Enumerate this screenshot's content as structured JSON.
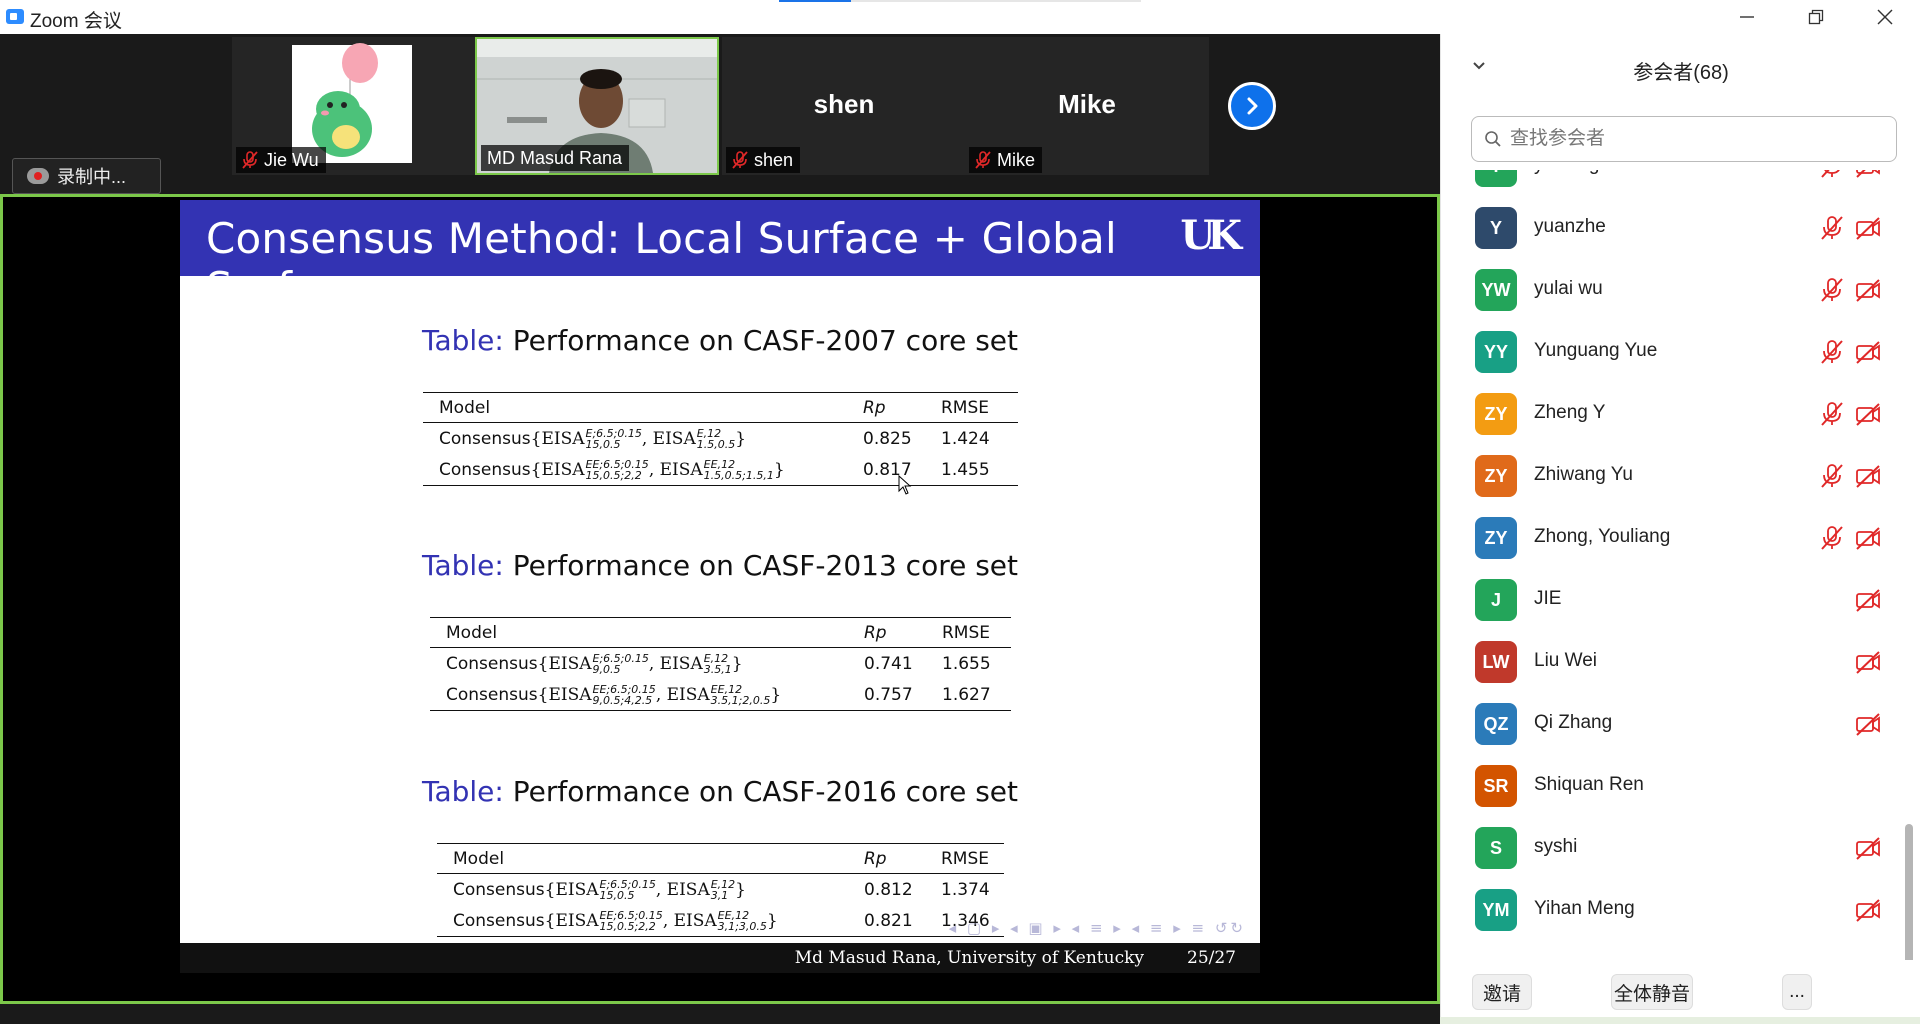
{
  "window": {
    "title": "Zoom 会议",
    "progress": 0.2
  },
  "gallery": {
    "tiles": [
      {
        "name": "Jie Wu",
        "big_name": ""
      },
      {
        "name": "MD Masud Rana",
        "big_name": ""
      },
      {
        "name": "shen",
        "big_name": "shen"
      },
      {
        "name": "Mike",
        "big_name": "Mike"
      }
    ]
  },
  "recording": {
    "label": "录制中..."
  },
  "slide": {
    "title": "Consensus Method:  Local Surface + Global Surface",
    "logo": "UK",
    "caption_prefix": "Table:",
    "tables": [
      {
        "caption": " Performance on CASF-2007 core set",
        "headers": {
          "model": "Model",
          "rp": "Rp",
          "rmse": "RMSE"
        },
        "rows": [
          {
            "model_prefix": "Consensus",
            "a_sup": "E;6.5;0.15",
            "a_sub": "15,0.5",
            "b_sup": "E,12",
            "b_sub": "1.5,0.5",
            "rp": "0.825",
            "rmse": "1.424"
          },
          {
            "model_prefix": "Consensus",
            "a_sup": "EE;6.5;0.15",
            "a_sub": "15,0.5;2,2",
            "b_sup": "EE,12",
            "b_sub": "1.5,0.5;1.5,1",
            "rp": "0.817",
            "rmse": "1.455"
          }
        ]
      },
      {
        "caption": " Performance on CASF-2013 core set",
        "headers": {
          "model": "Model",
          "rp": "Rp",
          "rmse": "RMSE"
        },
        "rows": [
          {
            "model_prefix": "Consensus",
            "a_sup": "E;6.5;0.15",
            "a_sub": "9,0.5",
            "b_sup": "E,12",
            "b_sub": "3.5,1",
            "rp": "0.741",
            "rmse": "1.655"
          },
          {
            "model_prefix": "Consensus",
            "a_sup": "EE;6.5;0.15",
            "a_sub": "9,0.5;4,2.5",
            "b_sup": "EE,12",
            "b_sub": "3.5,1;2,0.5",
            "rp": "0.757",
            "rmse": "1.627"
          }
        ]
      },
      {
        "caption": " Performance on CASF-2016 core set",
        "headers": {
          "model": "Model",
          "rp": "Rp",
          "rmse": "RMSE"
        },
        "rows": [
          {
            "model_prefix": "Consensus",
            "a_sup": "E;6.5;0.15",
            "a_sub": "15,0.5",
            "b_sup": "E,12",
            "b_sub": "3,1",
            "rp": "0.812",
            "rmse": "1.374"
          },
          {
            "model_prefix": "Consensus",
            "a_sup": "EE;6.5;0.15",
            "a_sub": "15,0.5;2,2",
            "b_sup": "EE,12",
            "b_sub": "3,1;3,0.5",
            "rp": "0.821",
            "rmse": "1.346"
          }
        ]
      }
    ],
    "footer_author": "Md Masud Rana, University of Kentucky",
    "footer_page": "25/27"
  },
  "participants": {
    "title": "参会者(68)",
    "search_placeholder": "查找参会者",
    "list": [
      {
        "initials": "Y",
        "name": "yisheng",
        "color": "#23a55a",
        "mic_muted": true,
        "video_off": true
      },
      {
        "initials": "Y",
        "name": "yuanzhe",
        "color": "#2e4a6b",
        "mic_muted": true,
        "video_off": true
      },
      {
        "initials": "YW",
        "name": "yulai wu",
        "color": "#23a55a",
        "mic_muted": true,
        "video_off": true
      },
      {
        "initials": "YY",
        "name": "Yunguang Yue",
        "color": "#18a085",
        "mic_muted": true,
        "video_off": true
      },
      {
        "initials": "ZY",
        "name": "Zheng Y",
        "color": "#f39c12",
        "mic_muted": true,
        "video_off": true
      },
      {
        "initials": "ZY",
        "name": "Zhiwang Yu",
        "color": "#e06a1a",
        "mic_muted": true,
        "video_off": true
      },
      {
        "initials": "ZY",
        "name": "Zhong, Youliang",
        "color": "#2b7bb9",
        "mic_muted": true,
        "video_off": true
      },
      {
        "initials": "J",
        "name": "JIE",
        "color": "#23a55a",
        "mic_muted": false,
        "video_off": true
      },
      {
        "initials": "LW",
        "name": "Liu Wei",
        "color": "#c0392b",
        "mic_muted": false,
        "video_off": true
      },
      {
        "initials": "QZ",
        "name": "Qi Zhang",
        "color": "#2b7bb9",
        "mic_muted": false,
        "video_off": true
      },
      {
        "initials": "SR",
        "name": "Shiquan Ren",
        "color": "#d35400",
        "mic_muted": false,
        "video_off": false
      },
      {
        "initials": "S",
        "name": "syshi",
        "color": "#23a55a",
        "mic_muted": false,
        "video_off": true
      },
      {
        "initials": "YM",
        "name": "Yihan Meng",
        "color": "#18a085",
        "mic_muted": false,
        "video_off": true
      }
    ],
    "buttons": {
      "invite": "邀请",
      "mute_all": "全体静音",
      "more": "..."
    }
  },
  "icon_colors": {
    "muted_red": "#e02828",
    "accent_blue": "#0e71eb",
    "active_green": "#7cc84a"
  }
}
